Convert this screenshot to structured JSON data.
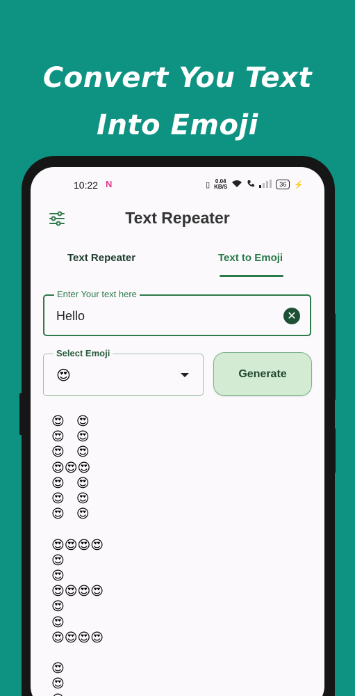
{
  "promo": {
    "headline_line1": "Convert You Text",
    "headline_line2": "Into Emoji"
  },
  "status_bar": {
    "time": "10:22",
    "app_badge": "N",
    "speed_value": "0.04",
    "speed_unit": "KB/S",
    "battery": "36"
  },
  "app": {
    "title": "Text Repeater",
    "menu_icon": "sliders-icon"
  },
  "tabs": [
    {
      "label": "Text Repeater",
      "selected": false
    },
    {
      "label": "Text to Emoji",
      "selected": true
    }
  ],
  "input": {
    "label": "Enter Your text here",
    "value": "Hello"
  },
  "emoji_select": {
    "label": "Select Emoji",
    "value": "😍"
  },
  "generate_button": {
    "label": "Generate"
  },
  "output": {
    "text": "😍   😍\n😍   😍\n😍   😍\n😍😍😍\n😍   😍\n😍   😍\n😍   😍\n\n😍😍😍😍\n😍\n😍\n😍😍😍😍\n😍\n😍\n😍😍😍😍\n\n😍\n😍\n😍"
  },
  "colors": {
    "background": "#0e9382",
    "accent": "#2f7a4b",
    "button_bg": "#d4ebd3"
  }
}
